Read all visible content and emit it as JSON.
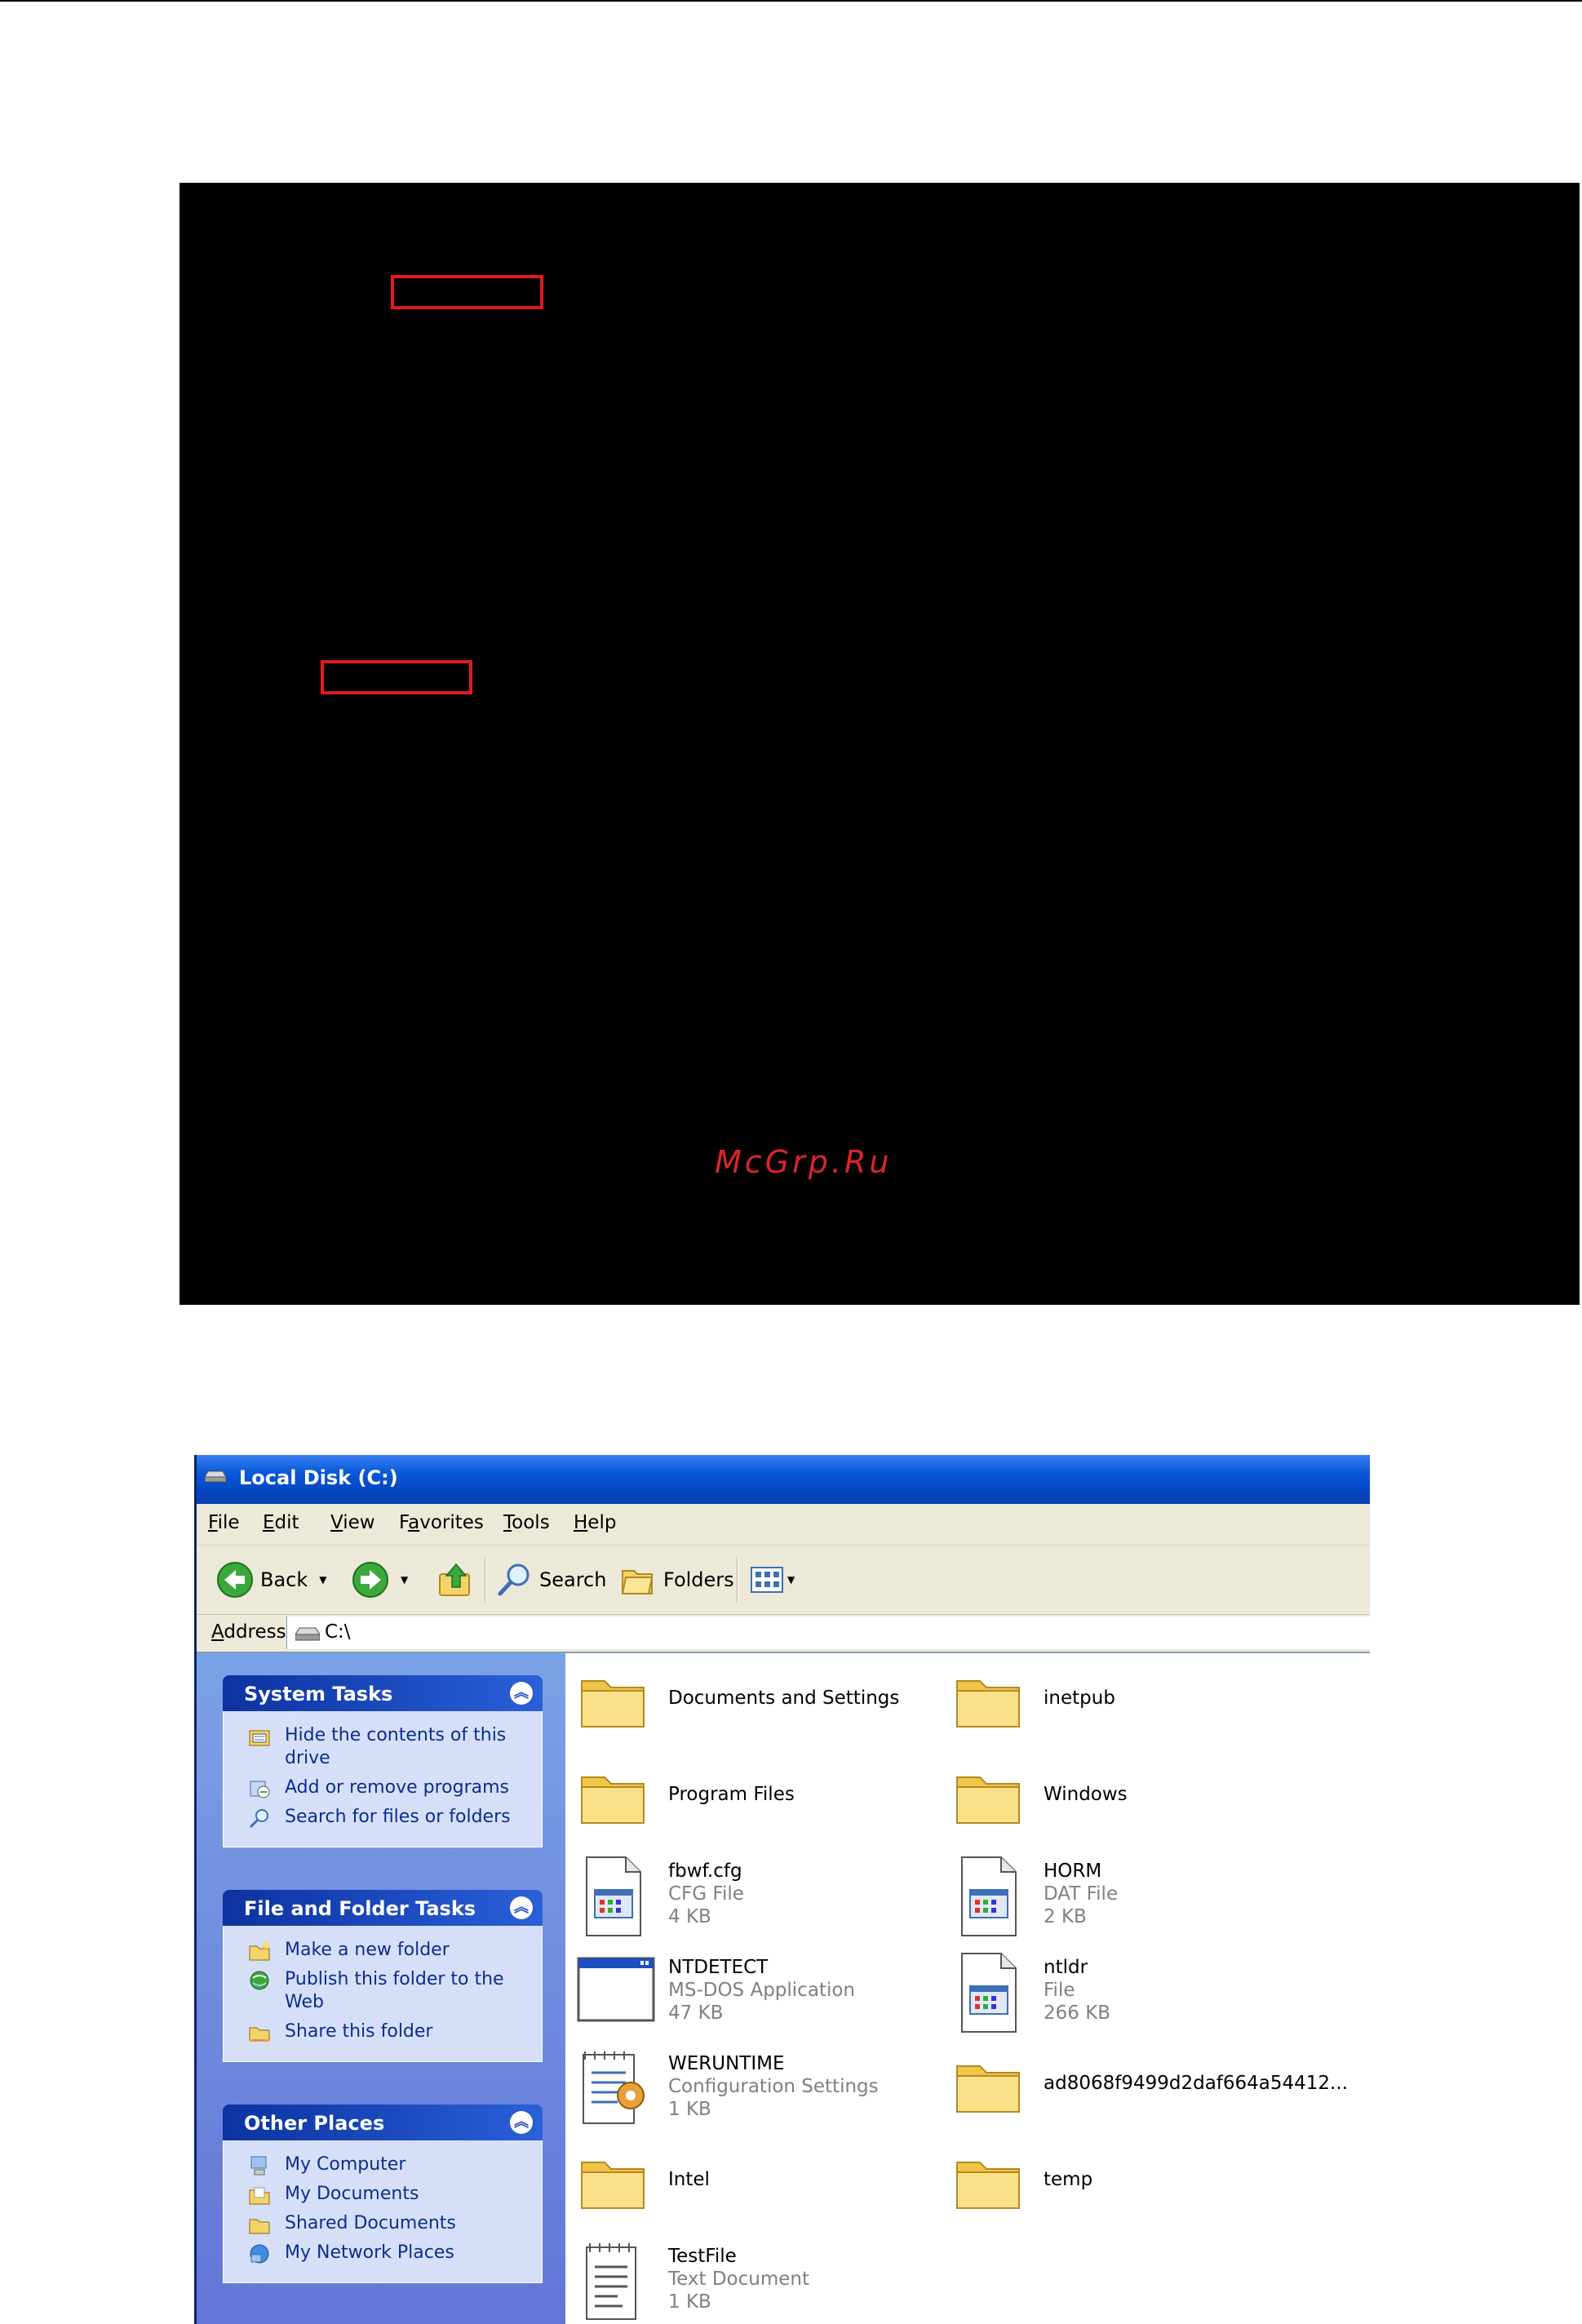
{
  "watermark": "McGrp.Ru",
  "window": {
    "title": "Local Disk (C:)",
    "menu": {
      "file": {
        "key": "F",
        "rest": "ile"
      },
      "edit": {
        "key": "E",
        "rest": "dit"
      },
      "view": {
        "key": "V",
        "rest": "iew"
      },
      "favorites": {
        "pre": "F",
        "key": "a",
        "rest": "vorites"
      },
      "tools": {
        "key": "T",
        "rest": "ools"
      },
      "help": {
        "key": "H",
        "rest": "elp"
      }
    },
    "toolbar": {
      "back": "Back",
      "search": "Search",
      "folders": "Folders"
    },
    "address": {
      "label_key": "A",
      "label_rest": "ddress",
      "value": "C:\\"
    }
  },
  "taskpane": {
    "system_tasks": {
      "title": "System Tasks",
      "items": [
        "Hide the contents of this drive",
        "Add or remove programs",
        "Search for files or folders"
      ]
    },
    "file_folder_tasks": {
      "title": "File and Folder Tasks",
      "items": [
        "Make a new folder",
        "Publish this folder to the Web",
        "Share this folder"
      ]
    },
    "other_places": {
      "title": "Other Places",
      "items": [
        "My Computer",
        "My Documents",
        "Shared Documents",
        "My Network Places"
      ]
    }
  },
  "files": [
    {
      "name": "Documents and Settings",
      "icon": "folder-icon"
    },
    {
      "name": "inetpub",
      "icon": "folder-icon"
    },
    {
      "name": "Program Files",
      "icon": "folder-icon"
    },
    {
      "name": "Windows",
      "icon": "folder-icon"
    },
    {
      "name": "fbwf.cfg",
      "type": "CFG File",
      "size": "4 KB",
      "icon": "system-file-icon"
    },
    {
      "name": "HORM",
      "type": "DAT File",
      "size": "2 KB",
      "icon": "system-file-icon"
    },
    {
      "name": "NTDETECT",
      "type": "MS-DOS Application",
      "size": "47 KB",
      "icon": "dos-app-icon"
    },
    {
      "name": "ntldr",
      "type": "File",
      "size": "266 KB",
      "icon": "system-file-icon"
    },
    {
      "name": "WERUNTIME",
      "type": "Configuration Settings",
      "size": "1 KB",
      "icon": "settings-file-icon"
    },
    {
      "name": "ad8068f9499d2daf664a54412...",
      "icon": "folder-icon"
    },
    {
      "name": "Intel",
      "icon": "folder-icon"
    },
    {
      "name": "temp",
      "icon": "folder-icon"
    },
    {
      "name": "TestFile",
      "type": "Text Document",
      "size": "1 KB",
      "icon": "text-file-icon"
    }
  ]
}
